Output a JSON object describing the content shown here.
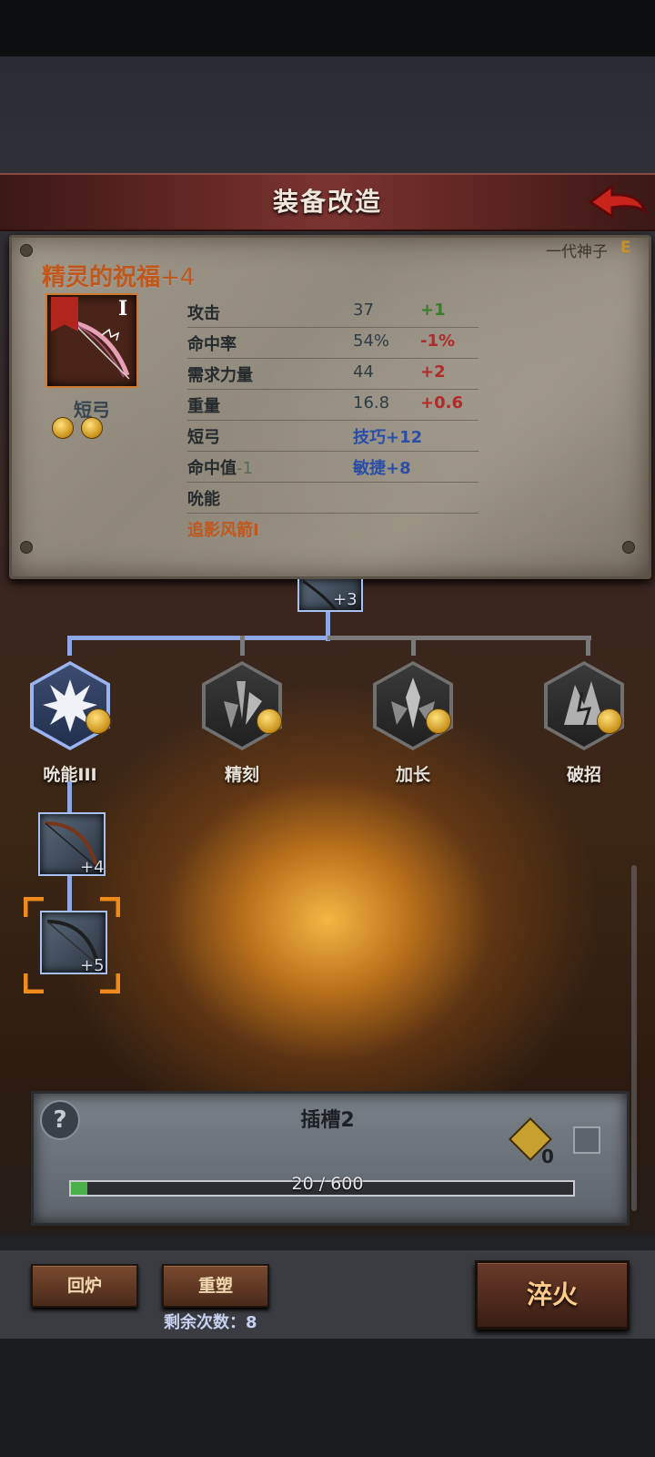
{
  "header": {
    "title": "装备改造",
    "back_label": "back"
  },
  "item": {
    "generation": "一代神子",
    "grade": "E",
    "name": "精灵的祝福",
    "enhance": "+4",
    "tier": "I",
    "type": "短弓",
    "gems": 2,
    "stats": [
      {
        "label": "攻击",
        "value": "37",
        "delta": "+1",
        "delta_sign": "pos"
      },
      {
        "label": "命中率",
        "value": "54%",
        "delta": "-1%",
        "delta_sign": "neg"
      },
      {
        "label": "需求力量",
        "value": "44",
        "delta": "+2",
        "delta_sign": "neg"
      },
      {
        "label": "重量",
        "value": "16.8",
        "delta": "+0.6",
        "delta_sign": "neg"
      }
    ],
    "traits": {
      "row1_label": "短弓",
      "row1_bonus": "技巧+12",
      "row2_label": "命中值",
      "row2_label_suffix": "-1",
      "row2_bonus": "敏捷+8",
      "row3_label": "吮能",
      "row4_label": "追影风箭I"
    }
  },
  "tree": {
    "top_slot": "+3",
    "nodes": [
      {
        "label": "吮能III",
        "icon": "burst-icon",
        "active": true
      },
      {
        "label": "精刻",
        "icon": "shard-icon",
        "active": false
      },
      {
        "label": "加长",
        "icon": "spike-icon",
        "active": false
      },
      {
        "label": "破招",
        "icon": "break-icon",
        "active": false
      }
    ],
    "slot_plus4": "+4",
    "slot_plus5": "+5"
  },
  "slot_panel": {
    "title": "插槽2",
    "token_count": "0",
    "progress_text": "20 / 600",
    "progress_current": 20,
    "progress_max": 600
  },
  "actions": {
    "smelt_label": "回炉",
    "reshape_label": "重塑",
    "remaining_label": "剩余次数：8",
    "quench_label": "淬火"
  },
  "colors": {
    "accent_orange": "#c0581e",
    "node_blue": "#8ea8e6",
    "positive": "#3c7a2c",
    "negative": "#b02a2a"
  }
}
